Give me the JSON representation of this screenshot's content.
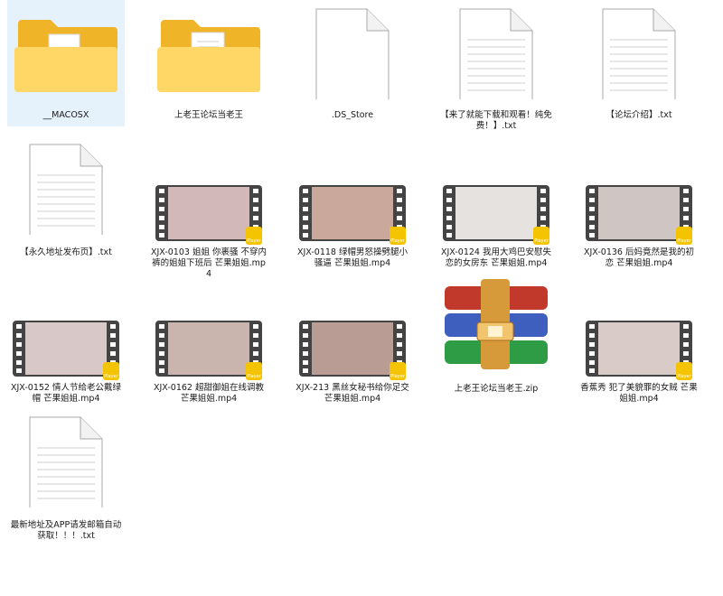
{
  "files": [
    {
      "name": "__MACOSX",
      "type": "folder",
      "selected": true
    },
    {
      "name": "上老王论坛当老王",
      "type": "folder",
      "selected": false
    },
    {
      "name": ".DS_Store",
      "type": "blank-file"
    },
    {
      "name": "【来了就能下载和观看！纯免费！】.txt",
      "type": "text-file"
    },
    {
      "name": "【论坛介绍】.txt",
      "type": "text-file"
    },
    {
      "name": "【永久地址发布页】.txt",
      "type": "text-file"
    },
    {
      "name": "XJX-0103 姐姐 你裹骚 不穿内裤的姐姐下班后 芒果姐姐.mp4",
      "type": "video-file",
      "badge": "Player"
    },
    {
      "name": "XJX-0118 绿帽男怒操劈腿小骚逼 芒果姐姐.mp4",
      "type": "video-file",
      "badge": "Player"
    },
    {
      "name": "XJX-0124 我用大鸡巴安慰失恋的女房东 芒果姐姐.mp4",
      "type": "video-file",
      "badge": "Player"
    },
    {
      "name": "XJX-0136 后妈竟然是我的初恋 芒果姐姐.mp4",
      "type": "video-file",
      "badge": "Player"
    },
    {
      "name": "XJX-0152 情人节给老公戴绿帽 芒果姐姐.mp4",
      "type": "video-file",
      "badge": "Player"
    },
    {
      "name": "XJX-0162 超甜御姐在线调教 芒果姐姐.mp4",
      "type": "video-file",
      "badge": "Player"
    },
    {
      "name": "XJX-213 黑丝女秘书给你足交 芒果姐姐.mp4",
      "type": "video-file",
      "badge": "Player"
    },
    {
      "name": "上老王论坛当老王.zip",
      "type": "archive-file"
    },
    {
      "name": "香蕉秀 犯了美貌罪的女贼 芒果姐姐.mp4",
      "type": "video-file",
      "badge": "Player"
    },
    {
      "name": "最新地址及APP请发邮箱自动获取！！！.txt",
      "type": "text-file"
    }
  ],
  "colors": {
    "selection": "#e5f1fb",
    "folder_back": "#f0b429",
    "folder_front": "#ffd766",
    "badge": "#f5c400"
  }
}
